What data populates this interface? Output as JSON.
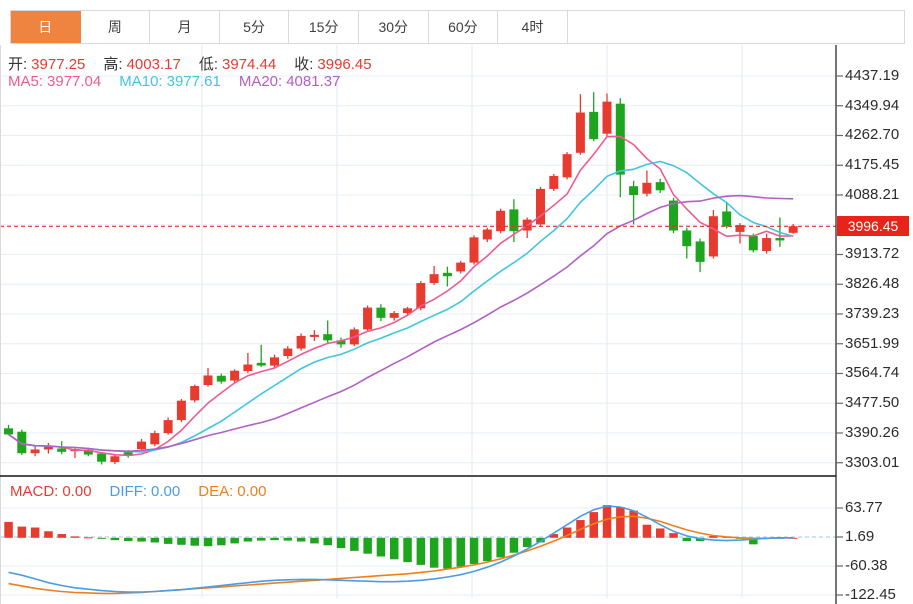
{
  "tabs": [
    {
      "id": "tab-day",
      "label": "日",
      "active": true
    },
    {
      "id": "tab-week",
      "label": "周",
      "active": false
    },
    {
      "id": "tab-month",
      "label": "月",
      "active": false
    },
    {
      "id": "tab-5min",
      "label": "5分",
      "active": false
    },
    {
      "id": "tab-15min",
      "label": "15分",
      "active": false
    },
    {
      "id": "tab-30min",
      "label": "30分",
      "active": false
    },
    {
      "id": "tab-60min",
      "label": "60分",
      "active": false
    },
    {
      "id": "tab-4hour",
      "label": "4时",
      "active": false
    }
  ],
  "ohlc_header": {
    "items": [
      {
        "label": "开:",
        "value": "3977.25"
      },
      {
        "label": "高:",
        "value": "4003.17"
      },
      {
        "label": "低:",
        "value": "3974.44"
      },
      {
        "label": "收:",
        "value": "3996.45"
      }
    ],
    "label_color": "#333333",
    "value_color": "#e83b30"
  },
  "ma_header": {
    "items": [
      {
        "label": "MA5:",
        "value": "3977.04",
        "color": "#ef5b90"
      },
      {
        "label": "MA10:",
        "value": "3977.61",
        "color": "#3ec6e0"
      },
      {
        "label": "MA20:",
        "value": "4081.37",
        "color": "#b25fc6"
      }
    ]
  },
  "macd_header": {
    "items": [
      {
        "label": "MACD:",
        "value": "0.00",
        "color": "#e83b30"
      },
      {
        "label": "DIFF:",
        "value": "0.00",
        "color": "#4a9ce8"
      },
      {
        "label": "DEA:",
        "value": "0.00",
        "color": "#ef7e1f"
      }
    ]
  },
  "price_tag": {
    "value": "3996.45"
  },
  "colors": {
    "up": "#e83b30",
    "down": "#1ea51e",
    "tab_active": "#ef8440",
    "price_line": "#e62e21",
    "price_tag_bg": "#e8231a",
    "ma5": "#ef5b90",
    "ma10": "#3ec6e0",
    "ma20": "#b25fc6",
    "diff_line": "#4a9ce8",
    "dea_line": "#ef7e1f",
    "grid": "#e7eef6",
    "vgrid": "#dfe9f3",
    "axis_line": "#3c3c3c",
    "label_text": "#2b2b2b",
    "zero_dash": "#aad5f5",
    "separator": "#141414",
    "border": "#d9d9d9"
  },
  "chart_data": {
    "type": "candlestick",
    "panels": [
      {
        "name": "price",
        "ylim": [
          3303.01,
          4437.19
        ],
        "axis_labels": [
          "4437.19",
          "4349.94",
          "4262.70",
          "4175.45",
          "4088.21",
          "3913.72",
          "3826.48",
          "3739.23",
          "3651.99",
          "3564.74",
          "3477.50",
          "3390.26",
          "3303.01"
        ],
        "grid_values": [
          4437.19,
          4349.94,
          4262.7,
          4175.45,
          4088.21,
          4000.96,
          3913.72,
          3826.48,
          3739.23,
          3651.99,
          3564.74,
          3477.5,
          3390.26,
          3303.01
        ],
        "last_price": 3996.45,
        "ma_periods": [
          5,
          10,
          20
        ],
        "candles": [
          [
            3404,
            3414,
            3383,
            3386
          ],
          [
            3394,
            3400,
            3326,
            3331
          ],
          [
            3331,
            3352,
            3322,
            3342
          ],
          [
            3342,
            3361,
            3330,
            3350
          ],
          [
            3345,
            3366,
            3328,
            3335
          ],
          [
            3337,
            3350,
            3317,
            3343
          ],
          [
            3341,
            3347,
            3322,
            3327
          ],
          [
            3330,
            3334,
            3298,
            3306
          ],
          [
            3305,
            3327,
            3299,
            3322
          ],
          [
            3334,
            3340,
            3318,
            3323
          ],
          [
            3343,
            3373,
            3338,
            3365
          ],
          [
            3357,
            3397,
            3352,
            3390
          ],
          [
            3390,
            3436,
            3385,
            3428
          ],
          [
            3428,
            3490,
            3422,
            3485
          ],
          [
            3486,
            3532,
            3480,
            3528
          ],
          [
            3531,
            3581,
            3526,
            3559
          ],
          [
            3558,
            3564,
            3535,
            3541
          ],
          [
            3544,
            3577,
            3538,
            3573
          ],
          [
            3572,
            3625,
            3566,
            3591
          ],
          [
            3596,
            3649,
            3584,
            3588
          ],
          [
            3588,
            3620,
            3582,
            3612
          ],
          [
            3616,
            3645,
            3608,
            3638
          ],
          [
            3638,
            3682,
            3632,
            3675
          ],
          [
            3672,
            3692,
            3660,
            3678
          ],
          [
            3680,
            3720,
            3655,
            3662
          ],
          [
            3662,
            3670,
            3640,
            3650
          ],
          [
            3650,
            3700,
            3645,
            3694
          ],
          [
            3694,
            3764,
            3688,
            3758
          ],
          [
            3758,
            3768,
            3718,
            3728
          ],
          [
            3728,
            3748,
            3720,
            3742
          ],
          [
            3742,
            3760,
            3734,
            3756
          ],
          [
            3756,
            3836,
            3750,
            3830
          ],
          [
            3830,
            3880,
            3824,
            3856
          ],
          [
            3860,
            3878,
            3820,
            3850
          ],
          [
            3864,
            3895,
            3858,
            3890
          ],
          [
            3890,
            3970,
            3884,
            3964
          ],
          [
            3958,
            3992,
            3950,
            3987
          ],
          [
            3982,
            4048,
            3976,
            4042
          ],
          [
            4046,
            4076,
            3950,
            3982
          ],
          [
            3984,
            4022,
            3962,
            4016
          ],
          [
            4002,
            4112,
            3996,
            4106
          ],
          [
            4106,
            4150,
            4100,
            4144
          ],
          [
            4140,
            4214,
            4134,
            4208
          ],
          [
            4212,
            4384,
            4206,
            4330
          ],
          [
            4332,
            4390,
            4246,
            4252
          ],
          [
            4268,
            4386,
            4260,
            4362
          ],
          [
            4356,
            4372,
            4082,
            4148
          ],
          [
            4114,
            4130,
            4002,
            4088
          ],
          [
            4092,
            4160,
            4084,
            4124
          ],
          [
            4126,
            4136,
            4094,
            4102
          ],
          [
            4072,
            4080,
            3976,
            3984
          ],
          [
            3984,
            3992,
            3902,
            3938
          ],
          [
            3952,
            3960,
            3862,
            3892
          ],
          [
            3908,
            4044,
            3902,
            4026
          ],
          [
            4040,
            4068,
            3990,
            3996
          ],
          [
            3980,
            4006,
            3946,
            4000
          ],
          [
            3968,
            3975,
            3920,
            3926
          ],
          [
            3924,
            3975,
            3916,
            3962
          ],
          [
            3962,
            4022,
            3936,
            3955
          ],
          [
            3977.25,
            4003.17,
            3974.44,
            3996.45
          ]
        ]
      },
      {
        "name": "macd",
        "ylim": [
          -122.45,
          63.77
        ],
        "axis_labels": [
          "63.77",
          "1.69",
          "-60.38",
          "-122.45"
        ],
        "zero_dash_value": 1.69,
        "hist": [
          34,
          24,
          22,
          14,
          8,
          3,
          1,
          -2,
          -5,
          -7,
          -8,
          -10,
          -13,
          -15,
          -17,
          -18,
          -16,
          -12,
          -8,
          -6,
          -5,
          -6,
          -8,
          -12,
          -16,
          -22,
          -28,
          -34,
          -40,
          -46,
          -52,
          -58,
          -64,
          -66,
          -62,
          -56,
          -50,
          -42,
          -32,
          -20,
          -10,
          8,
          22,
          38,
          55,
          70,
          66,
          58,
          28,
          20,
          10,
          -7,
          -7,
          4,
          2,
          -1,
          -14,
          -2,
          -1,
          0
        ],
        "diff": [
          -74,
          -80,
          -88,
          -96,
          -102,
          -107,
          -110,
          -113,
          -115,
          -116,
          -116,
          -115,
          -113,
          -111,
          -108,
          -105,
          -102,
          -99,
          -96,
          -93,
          -91,
          -90,
          -89,
          -89,
          -90,
          -91,
          -92,
          -93,
          -94,
          -94,
          -93,
          -91,
          -88,
          -84,
          -79,
          -72,
          -63,
          -52,
          -39,
          -24,
          -8,
          10,
          28,
          46,
          60,
          68,
          66,
          58,
          44,
          28,
          14,
          4,
          -2,
          -5,
          -6,
          -5,
          -3,
          -1,
          0,
          0
        ],
        "dea": [
          -98,
          -103,
          -108,
          -112,
          -115,
          -117,
          -118,
          -119,
          -119,
          -118,
          -117,
          -115,
          -113,
          -111,
          -109,
          -107,
          -105,
          -103,
          -101,
          -99,
          -97,
          -95,
          -93,
          -91,
          -89,
          -87,
          -85,
          -83,
          -81,
          -79,
          -77,
          -74,
          -71,
          -67,
          -63,
          -58,
          -52,
          -45,
          -37,
          -28,
          -18,
          -7,
          5,
          18,
          30,
          40,
          45,
          46,
          42,
          35,
          26,
          17,
          10,
          5,
          2,
          0,
          -1,
          -1,
          0,
          0
        ]
      }
    ]
  }
}
